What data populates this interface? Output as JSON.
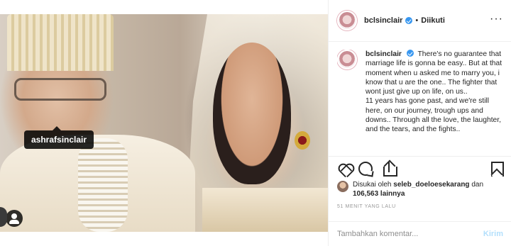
{
  "photo": {
    "tagged_user": "ashrafsinclair",
    "icons": {
      "user_tag": "user-tag-icon"
    }
  },
  "header": {
    "username": "bclsinclair",
    "separator": "•",
    "follow_label": "Diikuti",
    "more_label": "···",
    "verified_icon": "verified-badge-icon"
  },
  "caption": {
    "author": "bclsinclair",
    "text_line1": "There's no guarantee that marriage life is gonna be easy.. But at that moment when u asked me to marry you, i know that u are the one.. The fighter that wont just give up on life, on us..",
    "text_line2": "11 years has gone past, and we're still here, on our journey, trough ups and downs.. Through all the love, the laughter, and the tears, and the fights.."
  },
  "actions": {
    "icons": [
      "heart-icon",
      "comment-icon",
      "share-icon",
      "bookmark-icon"
    ]
  },
  "likes": {
    "prefix": "Disukai oleh",
    "liker": "seleb_doeloesekarang",
    "connector": "dan",
    "count_text": "106,563 lainnya"
  },
  "timestamp": "51 MENIT YANG LALU",
  "comment_box": {
    "placeholder": "Tambahkan komentar...",
    "post_label": "Kirim"
  },
  "colors": {
    "verified_blue": "#3897f0",
    "post_button_disabled": "#b2dffc",
    "text": "#262626",
    "muted": "#999999"
  }
}
